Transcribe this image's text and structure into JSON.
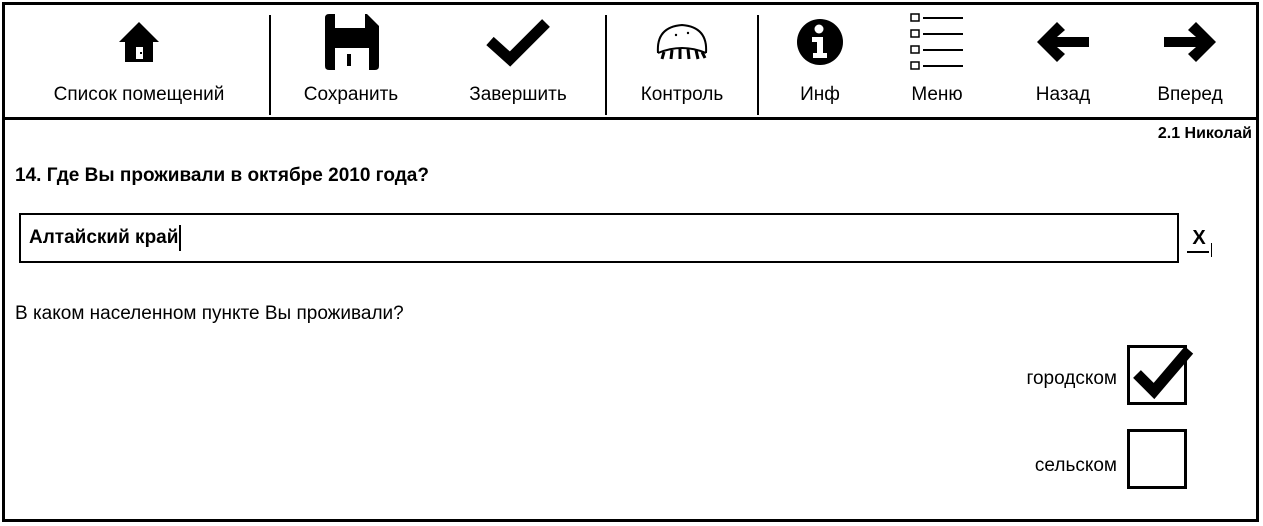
{
  "toolbar": {
    "items": [
      {
        "label": "Список помещений",
        "icon": "home-icon"
      },
      {
        "label": "Сохранить",
        "icon": "floppy-disk-icon"
      },
      {
        "label": "Завершить",
        "icon": "checkmark-icon"
      },
      {
        "label": "Контроль",
        "icon": "control-icon"
      },
      {
        "label": "Инф",
        "icon": "info-icon"
      },
      {
        "label": "Меню",
        "icon": "menu-list-icon"
      },
      {
        "label": "Назад",
        "icon": "arrow-left-icon"
      },
      {
        "label": "Вперед",
        "icon": "arrow-right-icon"
      }
    ]
  },
  "header": {
    "user": "2.1 Николай"
  },
  "question": {
    "text": "14. Где Вы проживали в октябре 2010 года?",
    "answer_value": "Алтайский край",
    "clear_label": "X"
  },
  "subquestion": {
    "text": "В каком населенном пункте Вы проживали?",
    "options": [
      {
        "label": "городском",
        "checked": true
      },
      {
        "label": "сельском",
        "checked": false
      }
    ]
  }
}
